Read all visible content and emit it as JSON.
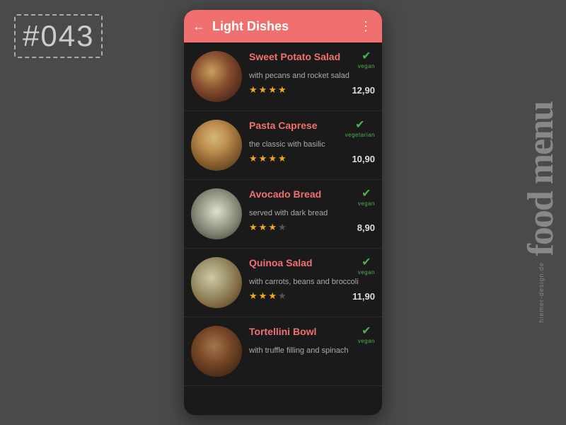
{
  "page": {
    "label": "#043",
    "right_text": "food menu",
    "brand": "hiemer-design.de"
  },
  "header": {
    "title": "Light Dishes",
    "back_icon": "←",
    "more_icon": "⋮"
  },
  "menu_items": [
    {
      "name": "Sweet Potato Salad",
      "description": "with pecans and rocket salad",
      "badge": "vegan",
      "stars": 4,
      "price": "12,90",
      "img_class": "img-sweet-potato"
    },
    {
      "name": "Pasta Caprese",
      "description": "the classic with basilic",
      "badge": "vegetarian",
      "stars": 4,
      "price": "10,90",
      "img_class": "img-pasta"
    },
    {
      "name": "Avocado Bread",
      "description": "served with dark bread",
      "badge": "vegan",
      "stars": 3,
      "price": "8,90",
      "img_class": "img-avocado"
    },
    {
      "name": "Quinoa Salad",
      "description": "with carrots, beans and broccoli",
      "badge": "vegan",
      "stars": 3,
      "price": "11,90",
      "img_class": "img-quinoa"
    },
    {
      "name": "Tortellini Bowl",
      "description": "with truffle filling and spinach",
      "badge": "vegan",
      "stars": 0,
      "price": "",
      "img_class": "img-tortellini"
    }
  ]
}
